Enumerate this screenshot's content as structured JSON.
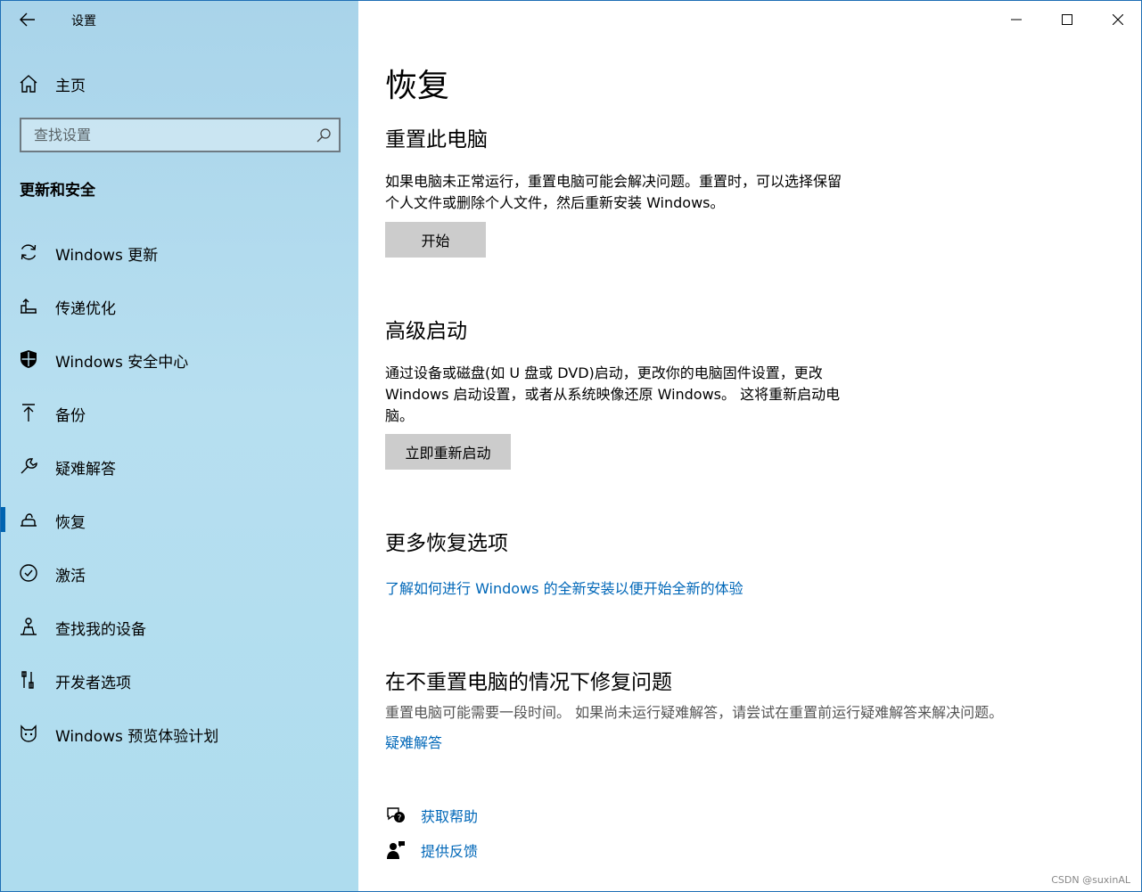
{
  "app": {
    "title": "设置"
  },
  "sidebar": {
    "home_label": "主页",
    "search_placeholder": "查找设置",
    "section_title": "更新和安全",
    "items": [
      {
        "label": "Windows 更新",
        "icon": "sync-icon"
      },
      {
        "label": "传递优化",
        "icon": "delivery-optimization-icon"
      },
      {
        "label": "Windows 安全中心",
        "icon": "shield-icon"
      },
      {
        "label": "备份",
        "icon": "backup-upload-icon"
      },
      {
        "label": "疑难解答",
        "icon": "wrench-icon"
      },
      {
        "label": "恢复",
        "icon": "recovery-icon",
        "selected": true
      },
      {
        "label": "激活",
        "icon": "check-circle-icon"
      },
      {
        "label": "查找我的设备",
        "icon": "find-device-icon"
      },
      {
        "label": "开发者选项",
        "icon": "developer-tools-icon"
      },
      {
        "label": "Windows 预览体验计划",
        "icon": "insider-cat-icon"
      }
    ]
  },
  "main": {
    "title": "恢复",
    "reset": {
      "heading": "重置此电脑",
      "line1": "如果电脑未正常运行，重置电脑可能会解决问题。重置时，可以选择保留",
      "line2": "个人文件或删除个人文件，然后重新安装 Windows。",
      "button": "开始"
    },
    "advanced": {
      "heading": "高级启动",
      "line1": "通过设备或磁盘(如 U 盘或 DVD)启动，更改你的电脑固件设置，更改",
      "line2": "Windows 启动设置，或者从系统映像还原 Windows。 这将重新启动电",
      "line3": "脑。",
      "button": "立即重新启动"
    },
    "more": {
      "heading": "更多恢复选项",
      "link": "了解如何进行 Windows 的全新安装以便开始全新的体验"
    },
    "fix": {
      "heading": "在不重置电脑的情况下修复问题",
      "text": "重置电脑可能需要一段时间。 如果尚未运行疑难解答，请尝试在重置前运行疑难解答来解决问题。",
      "link": "疑难解答"
    },
    "help": {
      "get_help": "获取帮助",
      "feedback": "提供反馈"
    }
  },
  "watermark": "CSDN @suxinAL",
  "colors": {
    "accent": "#0063b1",
    "link": "#0067b8",
    "button": "#cccccc"
  }
}
